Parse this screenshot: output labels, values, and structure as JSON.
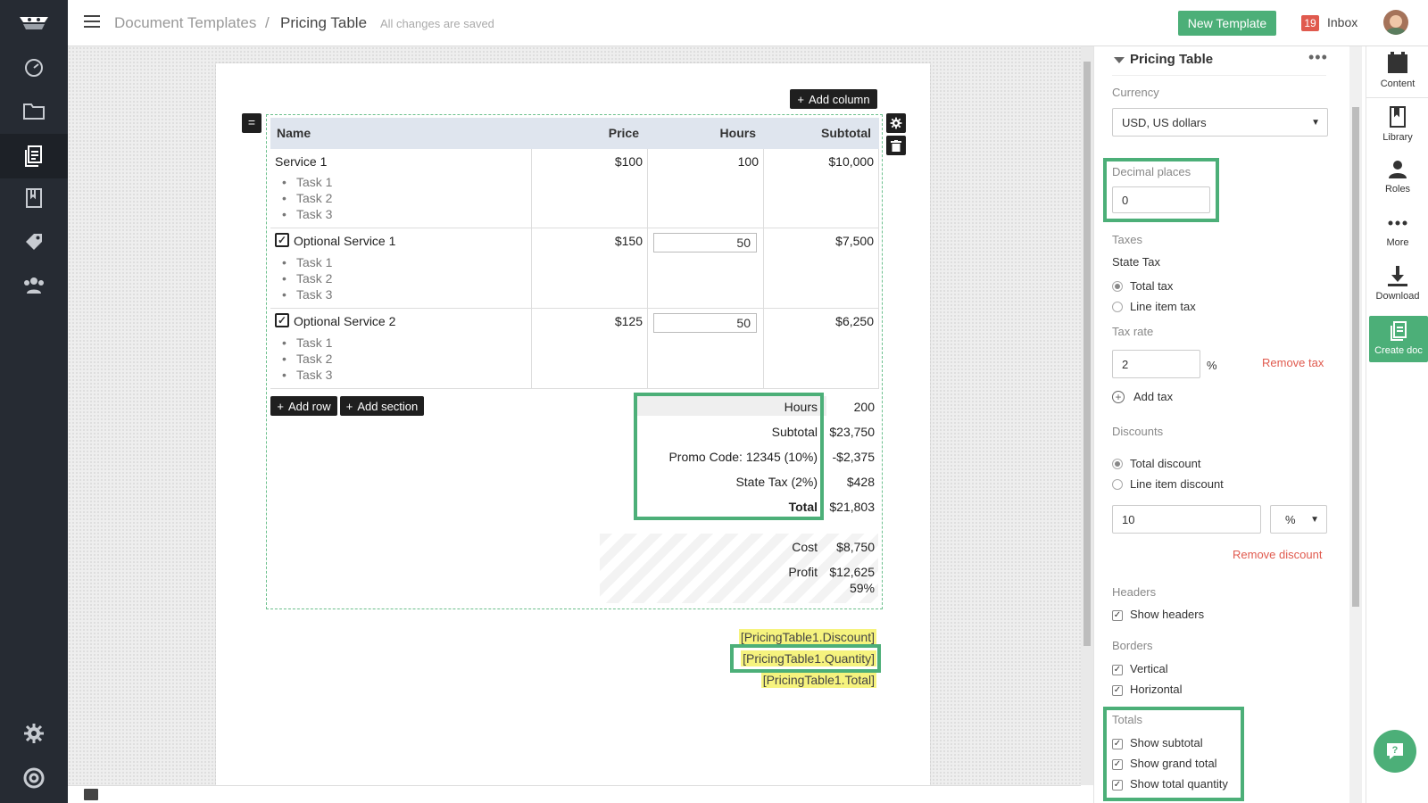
{
  "topbar": {
    "breadcrumb_root": "Document Templates",
    "breadcrumb_sep": "/",
    "breadcrumb_current": "Pricing Table",
    "save_status": "All changes are saved",
    "new_template_label": "New Template",
    "inbox_count": "19",
    "inbox_label": "Inbox"
  },
  "table_actions": {
    "add_column": "Add column",
    "add_row": "Add row",
    "add_section": "Add section"
  },
  "pricing_table": {
    "headers": {
      "name": "Name",
      "price": "Price",
      "hours": "Hours",
      "subtotal": "Subtotal"
    },
    "rows": [
      {
        "name": "Service 1",
        "price": "$100",
        "hours": "100",
        "subtotal": "$10,000",
        "tasks": [
          "Task 1",
          "Task 2",
          "Task 3"
        ]
      },
      {
        "name": "Optional Service 1",
        "price": "$150",
        "hours": "50",
        "subtotal": "$7,500",
        "tasks": [
          "Task 1",
          "Task 2",
          "Task 3"
        ]
      },
      {
        "name": "Optional Service 2",
        "price": "$125",
        "hours": "50",
        "subtotal": "$6,250",
        "tasks": [
          "Task 1",
          "Task 2",
          "Task 3"
        ]
      }
    ],
    "summary": {
      "hours_label": "Hours",
      "hours_value": "200",
      "subtotal_label": "Subtotal",
      "subtotal_value": "$23,750",
      "promo_label": "Promo Code: 12345 (10%)",
      "promo_value": "-$2,375",
      "tax_label": "State Tax (2%)",
      "tax_value": "$428",
      "total_label": "Total",
      "total_value": "$21,803"
    },
    "margin": {
      "cost_label": "Cost",
      "cost_value": "$8,750",
      "profit_label": "Profit",
      "profit_value": "$12,625",
      "profit_pct": "59%"
    }
  },
  "merge_fields": [
    "[PricingTable1.Discount]",
    "[PricingTable1.Quantity]",
    "[PricingTable1.Total]"
  ],
  "panel": {
    "title": "Pricing Table",
    "currency_label": "Currency",
    "currency_value": "USD, US dollars",
    "decimal_label": "Decimal places",
    "decimal_value": "0",
    "taxes_label": "Taxes",
    "tax_name": "State Tax",
    "tax_opt_total": "Total tax",
    "tax_opt_line": "Line item tax",
    "tax_rate_label": "Tax rate",
    "tax_rate_value": "2",
    "tax_rate_unit": "%",
    "remove_tax": "Remove tax",
    "add_tax": "Add tax",
    "discounts_label": "Discounts",
    "disc_opt_total": "Total discount",
    "disc_opt_line": "Line item discount",
    "discount_value": "10",
    "discount_unit": "%",
    "remove_discount": "Remove discount",
    "headers_label": "Headers",
    "show_headers": "Show headers",
    "borders_label": "Borders",
    "border_vertical": "Vertical",
    "border_horizontal": "Horizontal",
    "totals_label": "Totals",
    "show_subtotal": "Show subtotal",
    "show_grand_total": "Show grand total",
    "show_total_quantity": "Show total quantity"
  },
  "right_tabs": {
    "content": "Content",
    "library": "Library",
    "roles": "Roles",
    "more": "More",
    "download": "Download",
    "create_doc": "Create doc"
  },
  "colors": {
    "accent": "#4caf78",
    "nav_bg": "#262b33",
    "danger": "#e05a4e",
    "merge_bg": "#f6f37e"
  }
}
